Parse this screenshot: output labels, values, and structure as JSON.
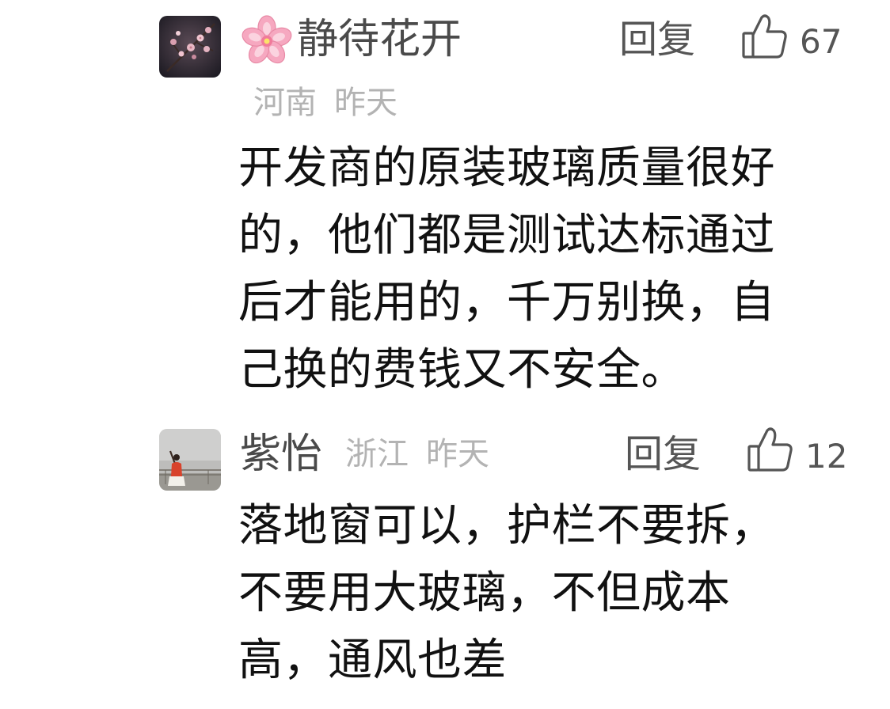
{
  "comments": [
    {
      "avatar_icon": "plum-blossom-photo",
      "name_emoji_icon": "cherry-blossom-icon",
      "name": "静待花开",
      "location": "河南",
      "time": "昨天",
      "reply_label": "回复",
      "like_icon": "thumbs-up-icon",
      "likes": "67",
      "text": "开发商的原装玻璃质量很好的，他们都是测试达标通过后才能用的，千万别换，自己换的费钱又不安全。"
    },
    {
      "avatar_icon": "person-by-sea-photo",
      "name": "紫怡",
      "location": "浙江",
      "time": "昨天",
      "reply_label": "回复",
      "like_icon": "thumbs-up-icon",
      "likes": "12",
      "text": "落地窗可以，护栏不要拆，不要用大玻璃，不但成本高，通风也差"
    }
  ]
}
